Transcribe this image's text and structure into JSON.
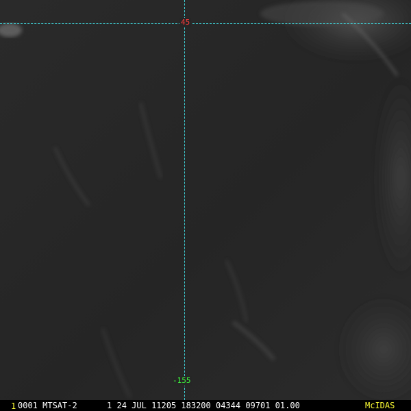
{
  "overlay": {
    "latitude_label": "45",
    "longitude_label": "-155"
  },
  "status_bar": {
    "frame_number": "1",
    "info": "0001 MTSAT-2      1 24 JUL 11205 183200 04344 09701 01.00",
    "brand": "McIDAS"
  },
  "colors": {
    "grid_line": "#3fd0d6",
    "latitude_label": "#ff3b3b",
    "longitude_label": "#3cff3c",
    "status_text": "#ffffff",
    "status_highlight": "#ffff33"
  }
}
